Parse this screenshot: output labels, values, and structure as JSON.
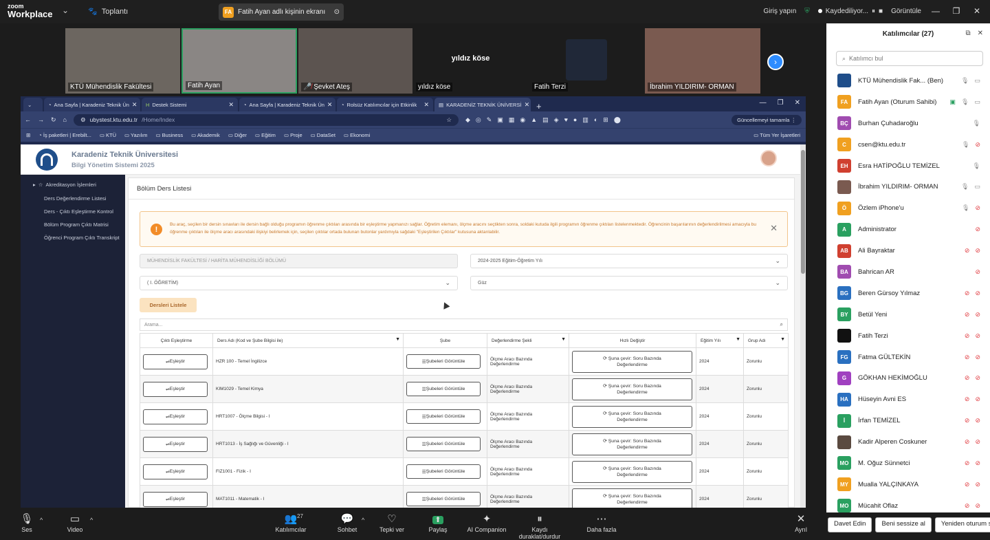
{
  "topbar": {
    "logo_top": "zoom",
    "logo_bottom": "Workplace",
    "meeting_label": "Toplantı",
    "share_initials": "FA",
    "share_label": "Fatih Ayan adlı kişinin ekranı",
    "signin": "Giriş yapın",
    "recording": "Kaydediliyor...",
    "view": "Görüntüle"
  },
  "videos": [
    {
      "name": "KTÜ Mühendislik Fakültesi",
      "bg": "#6c6660"
    },
    {
      "name": "Fatih Ayan",
      "bg": "#8a8684"
    },
    {
      "name": "Şevket Ateş",
      "bg": "#5c5450"
    },
    {
      "name": "yıldız köse",
      "big": "yıldız köse",
      "bg": "#1c1c1c"
    },
    {
      "name": "Fatih Terzi",
      "bg": "#1c1c1c"
    },
    {
      "name": "İbrahim YILDIRIM- ORMAN",
      "bg": "#7a5a50"
    }
  ],
  "browser": {
    "tabs": [
      {
        "label": "Ana Sayfa | Karadeniz Teknik Ün",
        "icon": "ktu-icon"
      },
      {
        "label": "Destek Sistemi",
        "icon": "h-icon"
      },
      {
        "label": "Ana Sayfa | Karadeniz Teknik Ün",
        "icon": "ktu-icon"
      },
      {
        "label": "Rolsüz Katılımcılar için Etkinlik",
        "icon": "ktu-icon"
      },
      {
        "label": "KARADENİZ TEKNİK ÜNİVERSİ",
        "icon": "page-icon"
      }
    ],
    "url_host": "ubystest.ktu.edu.tr",
    "url_path": "/Home/Index",
    "update_label": "Güncellemeyi tamamla",
    "bookmarks": [
      "İş paketleri | Erebilt...",
      "KTÜ",
      "Yazılım",
      "Business",
      "Akademik",
      "Diğer",
      "Eğitim",
      "Proje",
      "DataSet",
      "Ekonomi"
    ],
    "all_bookmarks": "Tüm Yer İşaretleri"
  },
  "site": {
    "title": "Karadeniz Teknik Üniversitesi",
    "subtitle": "Bilgi Yönetim Sistemi 2025",
    "sidebar_section": "Akreditasyon İşlemleri",
    "sidebar_items": [
      "Ders Değerlendirme Listesi",
      "Ders - Çıktı Eşleştirme Kontrol",
      "Bölüm Program Çıktı Matrisi",
      "Öğrenci Program Çıktı Transkript"
    ],
    "card_title": "Bölüm Ders Listesi",
    "alert_text": "Bu araç, seçilen bir dersin sınavları ile dersin bağlı olduğu programın öğrenme çıktıları arasında bir eşleştirme yapmanızı sağlar. Öğretim elemanı, ölçme aracını seçtikten sonra, soldaki kutuda ilgili programın öğrenme çıktıları listelenmektedir. Öğrencinin başarılarının değerlendirilmesi amacıyla bu öğrenme çıktıları ile ölçme aracı arasındaki ilişkiyi belirlemek için, seçilen çıktılar ortada bulunan butonlar yardımıyla sağdaki \"Eşleştirilen Çıktılar\" kutusuna aktarılabilir.",
    "select_dept": "MÜHENDİSLİK FAKÜLTESİ / HARİTA MÜHENDİSLİĞİ BÖLÜMÜ",
    "select_year": "2024-2025 Eğitim-Öğretim Yılı",
    "select_edu": "( I. ÖĞRETİM)",
    "select_term": "Güz",
    "list_button": "Dersleri Listele",
    "search_placeholder": "Arama...",
    "columns": [
      "Çıktı Eşleştirme",
      "Ders Adı (Kod ve Şube Bilgisi ile)",
      "Şube",
      "Değerlendirme Şekli",
      "Hızlı Değiştir",
      "Eğitim Yılı",
      "Grup Adı"
    ],
    "rows": [
      {
        "es": "Eşleştir",
        "ders": "HZR 100 - Temel İngilizce",
        "sube": "Şubeleri Görüntüle",
        "deg1": "Ölçme Aracı Bazında",
        "deg2": "Değerlendirme",
        "hz1": "Şuna çevir: Soru Bazında",
        "hz2": "Değerlendirme",
        "yil": "2024",
        "grup": "Zorunlu"
      },
      {
        "es": "Eşleştir",
        "ders": "KIM1029 - Temel Kimya",
        "sube": "Şubeleri Görüntüle",
        "deg1": "Ölçme Aracı Bazında",
        "deg2": "Değerlendirme",
        "hz1": "Şuna çevir: Soru Bazında",
        "hz2": "Değerlendirme",
        "yil": "2024",
        "grup": "Zorunlu"
      },
      {
        "es": "Eşleştir",
        "ders": "HRT1007 - Ölçme Bilgisi - I",
        "sube": "Şubeleri Görüntüle",
        "deg1": "Ölçme Aracı Bazında",
        "deg2": "Değerlendirme",
        "hz1": "Şuna çevir: Soru Bazında",
        "hz2": "Değerlendirme",
        "yil": "2024",
        "grup": "Zorunlu"
      },
      {
        "es": "Eşleştir",
        "ders": "HRT1013 - İş Sağlığı ve Güvenliği - I",
        "sube": "Şubeleri Görüntüle",
        "deg1": "Ölçme Aracı Bazında",
        "deg2": "Değerlendirme",
        "hz1": "Şuna çevir: Soru Bazında",
        "hz2": "Değerlendirme",
        "yil": "2024",
        "grup": "Zorunlu"
      },
      {
        "es": "Eşleştir",
        "ders": "FIZ1001 - Fizik - I",
        "sube": "Şubeleri Görüntüle",
        "deg1": "Ölçme Aracı Bazında",
        "deg2": "Değerlendirme",
        "hz1": "Şuna çevir: Soru Bazında",
        "hz2": "Değerlendirme",
        "yil": "2024",
        "grup": "Zorunlu"
      },
      {
        "es": "Eşleştir",
        "ders": "MAT1011 - Matematik - I",
        "sube": "Şubeleri Görüntüle",
        "deg1": "Ölçme Aracı Bazında",
        "deg2": "Değerlendirme",
        "hz1": "Şuna çevir: Soru Bazında",
        "hz2": "Değerlendirme",
        "yil": "2024",
        "grup": "Zorunlu"
      }
    ]
  },
  "participants": {
    "title": "Katılımcılar (27)",
    "search_placeholder": "Katılımcı bul",
    "list": [
      {
        "initials": "",
        "name": "KTÜ Mühendislik Fak... (Ben)",
        "color": "#1f4e8a",
        "icons": "on"
      },
      {
        "initials": "FA",
        "name": "Fatih Ayan (Oturum Sahibi)",
        "color": "#f0a020",
        "icons": "share"
      },
      {
        "initials": "BÇ",
        "name": "Burhan Çuhadaroğlu",
        "color": "#a04cb0",
        "icons": "mic"
      },
      {
        "initials": "C",
        "name": "csen@ktu.edu.tr",
        "color": "#f0a020",
        "icons": "micvidoff"
      },
      {
        "initials": "EH",
        "name": "Esra HATİPOĞLU TEMİZEL",
        "color": "#d04030",
        "icons": "mic"
      },
      {
        "initials": "",
        "name": "İbrahim YILDIRIM- ORMAN",
        "color": "#7a5a50",
        "icons": "on"
      },
      {
        "initials": "Ö",
        "name": "Özlem iPhone'u",
        "color": "#f0a020",
        "icons": "micvidoff"
      },
      {
        "initials": "A",
        "name": "Administrator",
        "color": "#2aa060",
        "icons": "muted"
      },
      {
        "initials": "AB",
        "name": "Ali Bayraktar",
        "color": "#d04030",
        "icons": "bothoff"
      },
      {
        "initials": "BA",
        "name": "Bahrican AR",
        "color": "#a04cb0",
        "icons": "muted"
      },
      {
        "initials": "BG",
        "name": "Beren Gürsoy Yılmaz",
        "color": "#2a70c0",
        "icons": "bothoff"
      },
      {
        "initials": "BY",
        "name": "Betül Yeni",
        "color": "#2aa060",
        "icons": "bothoff"
      },
      {
        "initials": "",
        "name": "Fatih Terzi",
        "color": "#111111",
        "icons": "bothoff"
      },
      {
        "initials": "FG",
        "name": "Fatma GÜLTEKİN",
        "color": "#2a70c0",
        "icons": "bothoff"
      },
      {
        "initials": "G",
        "name": "GÖKHAN HEKİMOĞLU",
        "color": "#a040c0",
        "icons": "bothoff"
      },
      {
        "initials": "HA",
        "name": "Hüseyin Avni ES",
        "color": "#2a70c0",
        "icons": "bothoff"
      },
      {
        "initials": "İ",
        "name": "İrfan TEMİZEL",
        "color": "#2aa060",
        "icons": "bothoff"
      },
      {
        "initials": "",
        "name": "Kadir Alperen Coskuner",
        "color": "#5a4a40",
        "icons": "bothoff"
      },
      {
        "initials": "MO",
        "name": "M. Oğuz Sünnetci",
        "color": "#2aa060",
        "icons": "bothoff"
      },
      {
        "initials": "MY",
        "name": "Mualla YALÇINKAYA",
        "color": "#f0a020",
        "icons": "bothoff"
      },
      {
        "initials": "MO",
        "name": "Mücahit Oflaz",
        "color": "#2aa060",
        "icons": "bothoff"
      }
    ],
    "buttons": [
      "Davet Edin",
      "Beni sessize al",
      "Yeniden oturum sahibi ol"
    ]
  },
  "toolbar": {
    "items": [
      {
        "label": "Ses",
        "icon": "🎙"
      },
      {
        "label": "Video",
        "icon": "▭"
      },
      {
        "label": "Katılımcılar",
        "icon": "👥",
        "count": "27"
      },
      {
        "label": "Sohbet",
        "icon": "💬"
      },
      {
        "label": "Tepki ver",
        "icon": "♡"
      },
      {
        "label": "Paylaş",
        "icon": "⬆"
      },
      {
        "label": "AI Companion",
        "icon": "✦"
      },
      {
        "label": "Kaydı duraklat/durdur",
        "icon": "⏸"
      },
      {
        "label": "Daha fazla",
        "icon": "⋯"
      },
      {
        "label": "Ayrıl",
        "icon": "✕"
      }
    ]
  }
}
